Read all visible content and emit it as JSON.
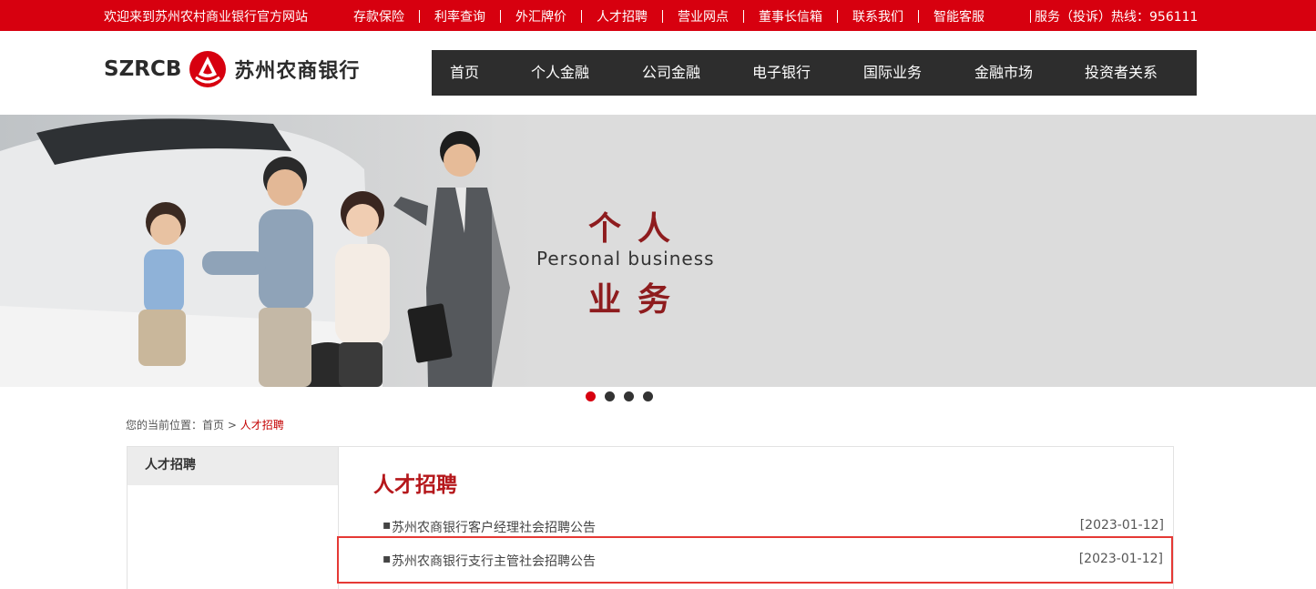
{
  "topbar": {
    "welcome": "欢迎来到苏州农村商业银行官方网站",
    "links": [
      "存款保险",
      "利率查询",
      "外汇牌价",
      "人才招聘",
      "营业网点",
      "董事长信箱",
      "联系我们",
      "智能客服"
    ],
    "hotline": "服务（投诉）热线：956111"
  },
  "logo": {
    "en": "SZRCB",
    "cn": "苏州农商银行"
  },
  "mainnav": [
    "首页",
    "个人金融",
    "公司金融",
    "电子银行",
    "国际业务",
    "金融市场",
    "投资者关系"
  ],
  "banner": {
    "line1": "个人",
    "line2": "Personal business",
    "line3": "业务"
  },
  "carousel": {
    "count": 4,
    "active": 0
  },
  "breadcrumb": {
    "prefix": "您的当前位置：",
    "home": "首页",
    "sep": " > ",
    "current": "人才招聘"
  },
  "sidebar": {
    "title": "人才招聘"
  },
  "content": {
    "title": "人才招聘",
    "items": [
      {
        "bullet": "▪",
        "title": "苏州农商银行客户经理社会招聘公告",
        "date": "[2023-01-12]"
      },
      {
        "bullet": "▪",
        "title": "苏州农商银行支行主管社会招聘公告",
        "date": "[2023-01-12]"
      }
    ]
  },
  "colors": {
    "brand_red": "#d7000f",
    "title_red": "#b5171b",
    "nav_bg": "#2d2d2d",
    "highlight": "#e53935"
  }
}
